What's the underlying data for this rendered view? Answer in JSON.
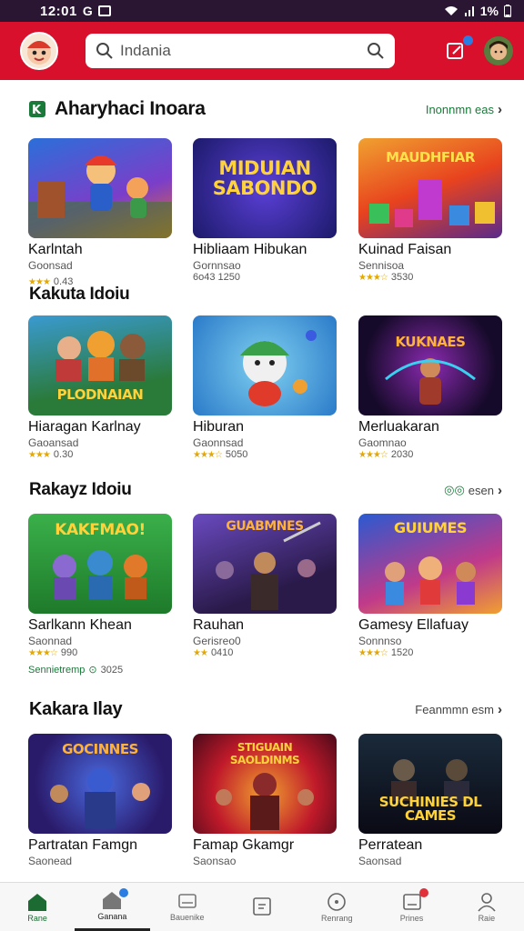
{
  "status_bar": {
    "time": "12:01",
    "battery": "1%"
  },
  "search": {
    "value": "Indania"
  },
  "sections": [
    {
      "title": "Aharyhaci Inoara",
      "see_all": "Inonnmn eas",
      "games": [
        {
          "title": "Karlntah",
          "sub": "Goonsad",
          "meta": "0.43",
          "art": ""
        },
        {
          "title": "Hibliaam Hibukan",
          "sub": "Gornnsao",
          "meta": "6o43  1250",
          "art": "MIDUIAN SABONDO"
        },
        {
          "title": "Kuinad Faisan",
          "sub": "Sennisoa",
          "meta": "3530",
          "art": "MAUDHFIAR"
        }
      ]
    },
    {
      "title": "Kakuta Idoiu",
      "see_all": "",
      "games": [
        {
          "title": "Hiaragan Karlnay",
          "sub": "Gaoansad",
          "meta": "0.30",
          "art": "PLODNAIAN"
        },
        {
          "title": "Hiburan",
          "sub": "Gaonnsad",
          "meta": "5050",
          "art": ""
        },
        {
          "title": "Merluakaran",
          "sub": "Gaomnao",
          "meta": "2030",
          "art": "KUKNAES"
        }
      ]
    },
    {
      "title": "Rakayz Idoiu",
      "see_all": "esen",
      "games": [
        {
          "title": "Sarlkann Khean",
          "sub": "Saonnad",
          "meta": "990",
          "art": "KAKFMAO!",
          "extra": "Sennietremp",
          "extra_num": "3025"
        },
        {
          "title": "Rauhan",
          "sub": "Gerisreo0",
          "meta": "0410",
          "art": "GUABMNES"
        },
        {
          "title": "Gamesy Ellafuay",
          "sub": "Sonnnso",
          "meta": "1520",
          "art": "GUIUMES"
        }
      ]
    },
    {
      "title": "Kakara Ilay",
      "see_all": "Feanmmn esm",
      "games": [
        {
          "title": "Partratan Famgn",
          "sub": "Saonead",
          "meta": "",
          "art": "GOCINNES"
        },
        {
          "title": "Famap Gkamgr",
          "sub": "Saonsao",
          "meta": "",
          "art": "STIGUAIN SAOLDINMS"
        },
        {
          "title": "Perratean",
          "sub": "Saonsad",
          "meta": "",
          "art": "SUCHINIES DL CAMES"
        }
      ]
    }
  ],
  "nav": [
    {
      "label": "Rane",
      "icon": "home-icon"
    },
    {
      "label": "Ganana",
      "icon": "store-icon"
    },
    {
      "label": "Bauenike",
      "icon": "library-icon"
    },
    {
      "label": "",
      "icon": "tasks-icon"
    },
    {
      "label": "Renrang",
      "icon": "compass-icon"
    },
    {
      "label": "Prines",
      "icon": "inbox-icon"
    },
    {
      "label": "Raie",
      "icon": "user-icon"
    }
  ]
}
